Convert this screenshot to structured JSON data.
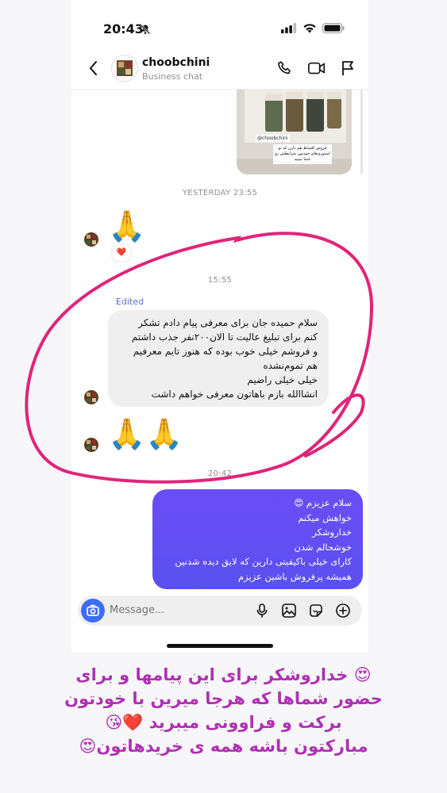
{
  "status": {
    "time": "20:43"
  },
  "header": {
    "name": "choobchini",
    "subtitle": "Business chat"
  },
  "media": {
    "watermark": "@choobchini",
    "overlay_text": "فروش اقساط هم دارن که تو استوری‌های خودتون شرایطش رو حتما ببینید"
  },
  "timestamps": {
    "yesterday": "YESTERDAY 23:55",
    "t1": "15:55",
    "t2": "20:42"
  },
  "messages": {
    "emoji_1": "🙏",
    "reaction": "❤️",
    "edited_label": "Edited",
    "incoming_lines": [
      "سلام حمیده جان برای معرفی پیام دادم  تشکر",
      "کنم  برای تبلیغ عالیت تا الان۲۰۰نفر جذب داشتم",
      "و فروشم خیلی خوب بوده که هنوز تایم معرفیم",
      "هم تموم‌نشده",
      "خیلی خیلی راضیم",
      "انشاالله بازم باهاتون معرفی خواهم داشت"
    ],
    "emoji_2": "🙏🙏",
    "outgoing_lines": [
      "سلام عزیزم 😍",
      "خواهش میکنم",
      "خداروشکر",
      "خوشحالم شدن",
      "کارای خیلی باکیفیتی دارین که لایق دیده شدنین",
      "همیشه پرفروش باشین عزیزم"
    ]
  },
  "composer": {
    "placeholder": "Message..."
  },
  "caption": {
    "lines": [
      "😍 خداروشکر برای این پیامها و برای",
      "حضور شماها که هرجا میرین با خودتون",
      "برکت و فراوونی میبرید ❤️😘",
      "مبارکتون باشه همه ی خریدهاتون😍"
    ]
  },
  "colors": {
    "outgoing_bubble": "#5e4ff2",
    "annotation": "#e0247a",
    "caption": "#b030b3"
  }
}
